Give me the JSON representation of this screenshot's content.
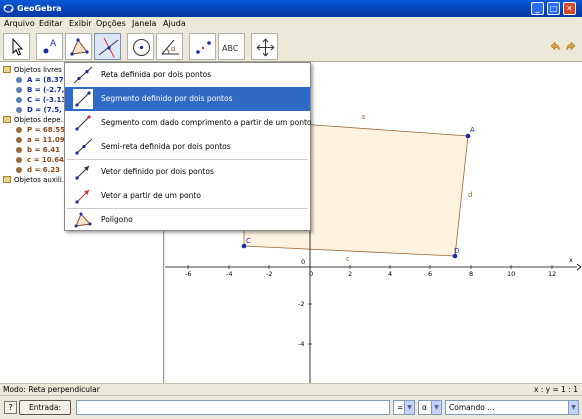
{
  "window": {
    "title": "GeoGebra"
  },
  "menu": [
    "Arquivo",
    "Editar",
    "Exibir",
    "Opções",
    "Janela",
    "Ajuda"
  ],
  "tools": [
    {
      "name": "move-tool",
      "icon": "arrow-cursor-icon"
    },
    {
      "name": "new-point-tool",
      "icon": "point-icon",
      "label": "A"
    },
    {
      "name": "perpendicular-tool",
      "icon": "triangle-icon"
    },
    {
      "name": "line-tool",
      "icon": "line-icon"
    },
    {
      "name": "circle-tool",
      "icon": "circle-icon"
    },
    {
      "name": "angle-tool",
      "icon": "angle-icon",
      "label": "α"
    },
    {
      "name": "reflect-tool",
      "icon": "reflect-icon"
    },
    {
      "name": "text-tool",
      "icon": "text-icon",
      "label": "ABC"
    },
    {
      "name": "translate-view-tool",
      "icon": "move-cross-icon"
    }
  ],
  "algebra": {
    "free_folder": "Objetos livres",
    "free": [
      "A = (8.37, …",
      "B = (-2.7, …",
      "C = (-3.13, …",
      "D = (7.5, 0…"
    ],
    "dependent_folder": "Objetos depe…",
    "dependent": [
      "P = 68.55",
      "a = 11.09",
      "b = 6.41",
      "c = 10.64",
      "d = 6.23"
    ],
    "aux_folder": "Objetos auxili…"
  },
  "dropdown": {
    "items": [
      "Reta definida por dois pontos",
      "Segmento definido por dois pontos",
      "Segmento com dado comprimento a partir de um ponto",
      "Semi-reta definida por dois pontos",
      "Vetor definido por dois pontos",
      "Vetor a partir de um ponto",
      "Polígono"
    ]
  },
  "graphics": {
    "points": [
      "A",
      "C",
      "D"
    ],
    "segments": [
      "a",
      "c",
      "d"
    ],
    "x_ticks": [
      "-6",
      "-4",
      "-2",
      "0",
      "2",
      "4",
      "6",
      "8",
      "10",
      "12"
    ],
    "y_ticks": [
      "-2",
      "-4",
      "0"
    ],
    "x_axis_label": "x",
    "y_axis_label": "y"
  },
  "status": {
    "mode": "Modo: Reta perpendicular",
    "ratio": "x : y = 1 : 1"
  },
  "input": {
    "help": "?",
    "entrada": "Entrada:",
    "combo_equals": "=",
    "combo_alpha": "α",
    "combo_command": "Comando ..."
  },
  "colors": {
    "polygon_fill": "#fff3e0",
    "polygon_edge": "#996633",
    "point": "#1a2aa0",
    "selected": "#3169c6"
  }
}
